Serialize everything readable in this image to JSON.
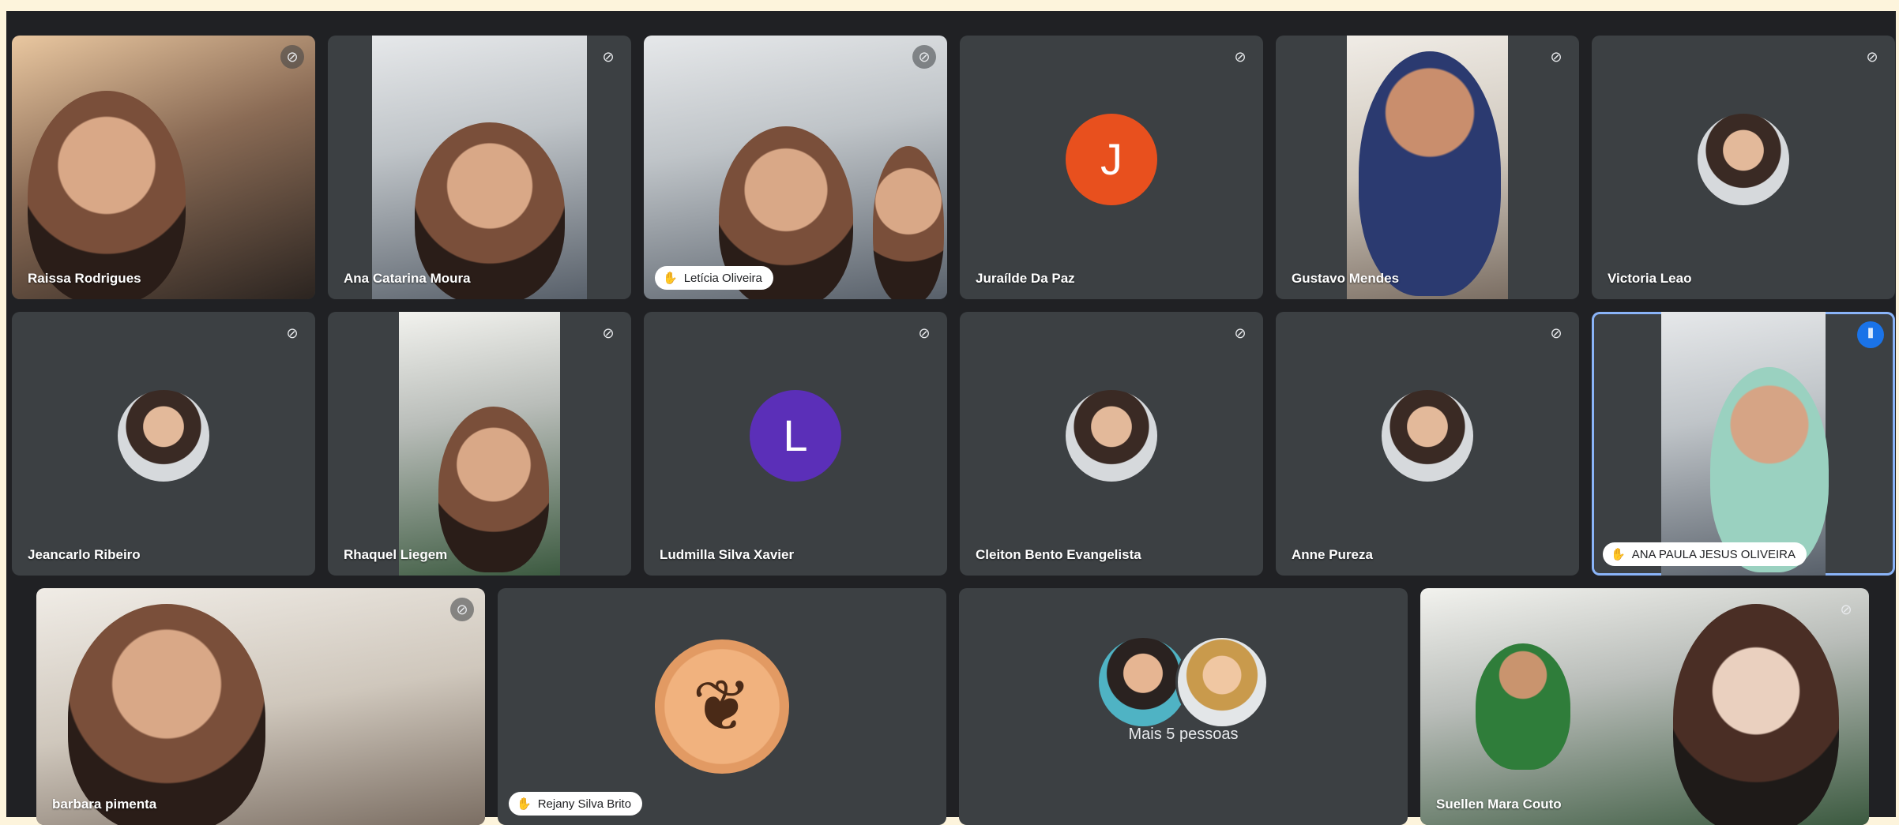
{
  "colors": {
    "page_background": "#fdf4dc",
    "stage_background": "#202124",
    "tile_background": "#3c4043",
    "active_speaker_outline": "#8ab4f8",
    "speaking_indicator": "#1a73e8",
    "avatar_J": "#e8501e",
    "avatar_L": "#5b2fb8"
  },
  "participants": [
    {
      "name": "Raissa Rodrigues",
      "state": "video",
      "muted": true
    },
    {
      "name": "Ana Catarina Moura",
      "state": "video",
      "muted": true
    },
    {
      "name": "Letícia Oliveira",
      "state": "video",
      "muted": true,
      "hand_raised": true
    },
    {
      "name": "Juraílde Da Paz",
      "state": "avatar",
      "initial": "J",
      "muted": true
    },
    {
      "name": "Gustavo Mendes",
      "state": "video",
      "muted": true
    },
    {
      "name": "Victoria Leao",
      "state": "avatar-photo",
      "muted": true
    },
    {
      "name": "Jeancarlo Ribeiro",
      "state": "avatar-photo",
      "muted": true
    },
    {
      "name": "Rhaquel Liegem",
      "state": "video",
      "muted": true
    },
    {
      "name": "Ludmilla Silva Xavier",
      "state": "avatar",
      "initial": "L",
      "muted": true
    },
    {
      "name": "Cleiton Bento Evangelista",
      "state": "avatar-photo",
      "muted": true
    },
    {
      "name": "Anne Pureza",
      "state": "avatar-photo",
      "muted": true
    },
    {
      "name": "ANA PAULA JESUS OLIVEIRA",
      "state": "video",
      "speaking": true,
      "hand_raised": true
    },
    {
      "name": "barbara pimenta",
      "state": "video",
      "muted": true
    },
    {
      "name": "Rejany Silva Brito",
      "state": "avatar-photo",
      "hand_raised": true
    },
    {
      "name": "Suellen Mara Couto",
      "state": "video",
      "muted": true
    }
  ],
  "overflow_tile": {
    "label": "Mais 5 pessoas"
  },
  "icons": {
    "mic_off": "mic-off-icon",
    "hand_raised": "hand-raised-icon",
    "speaking": "speaking-indicator-icon"
  }
}
